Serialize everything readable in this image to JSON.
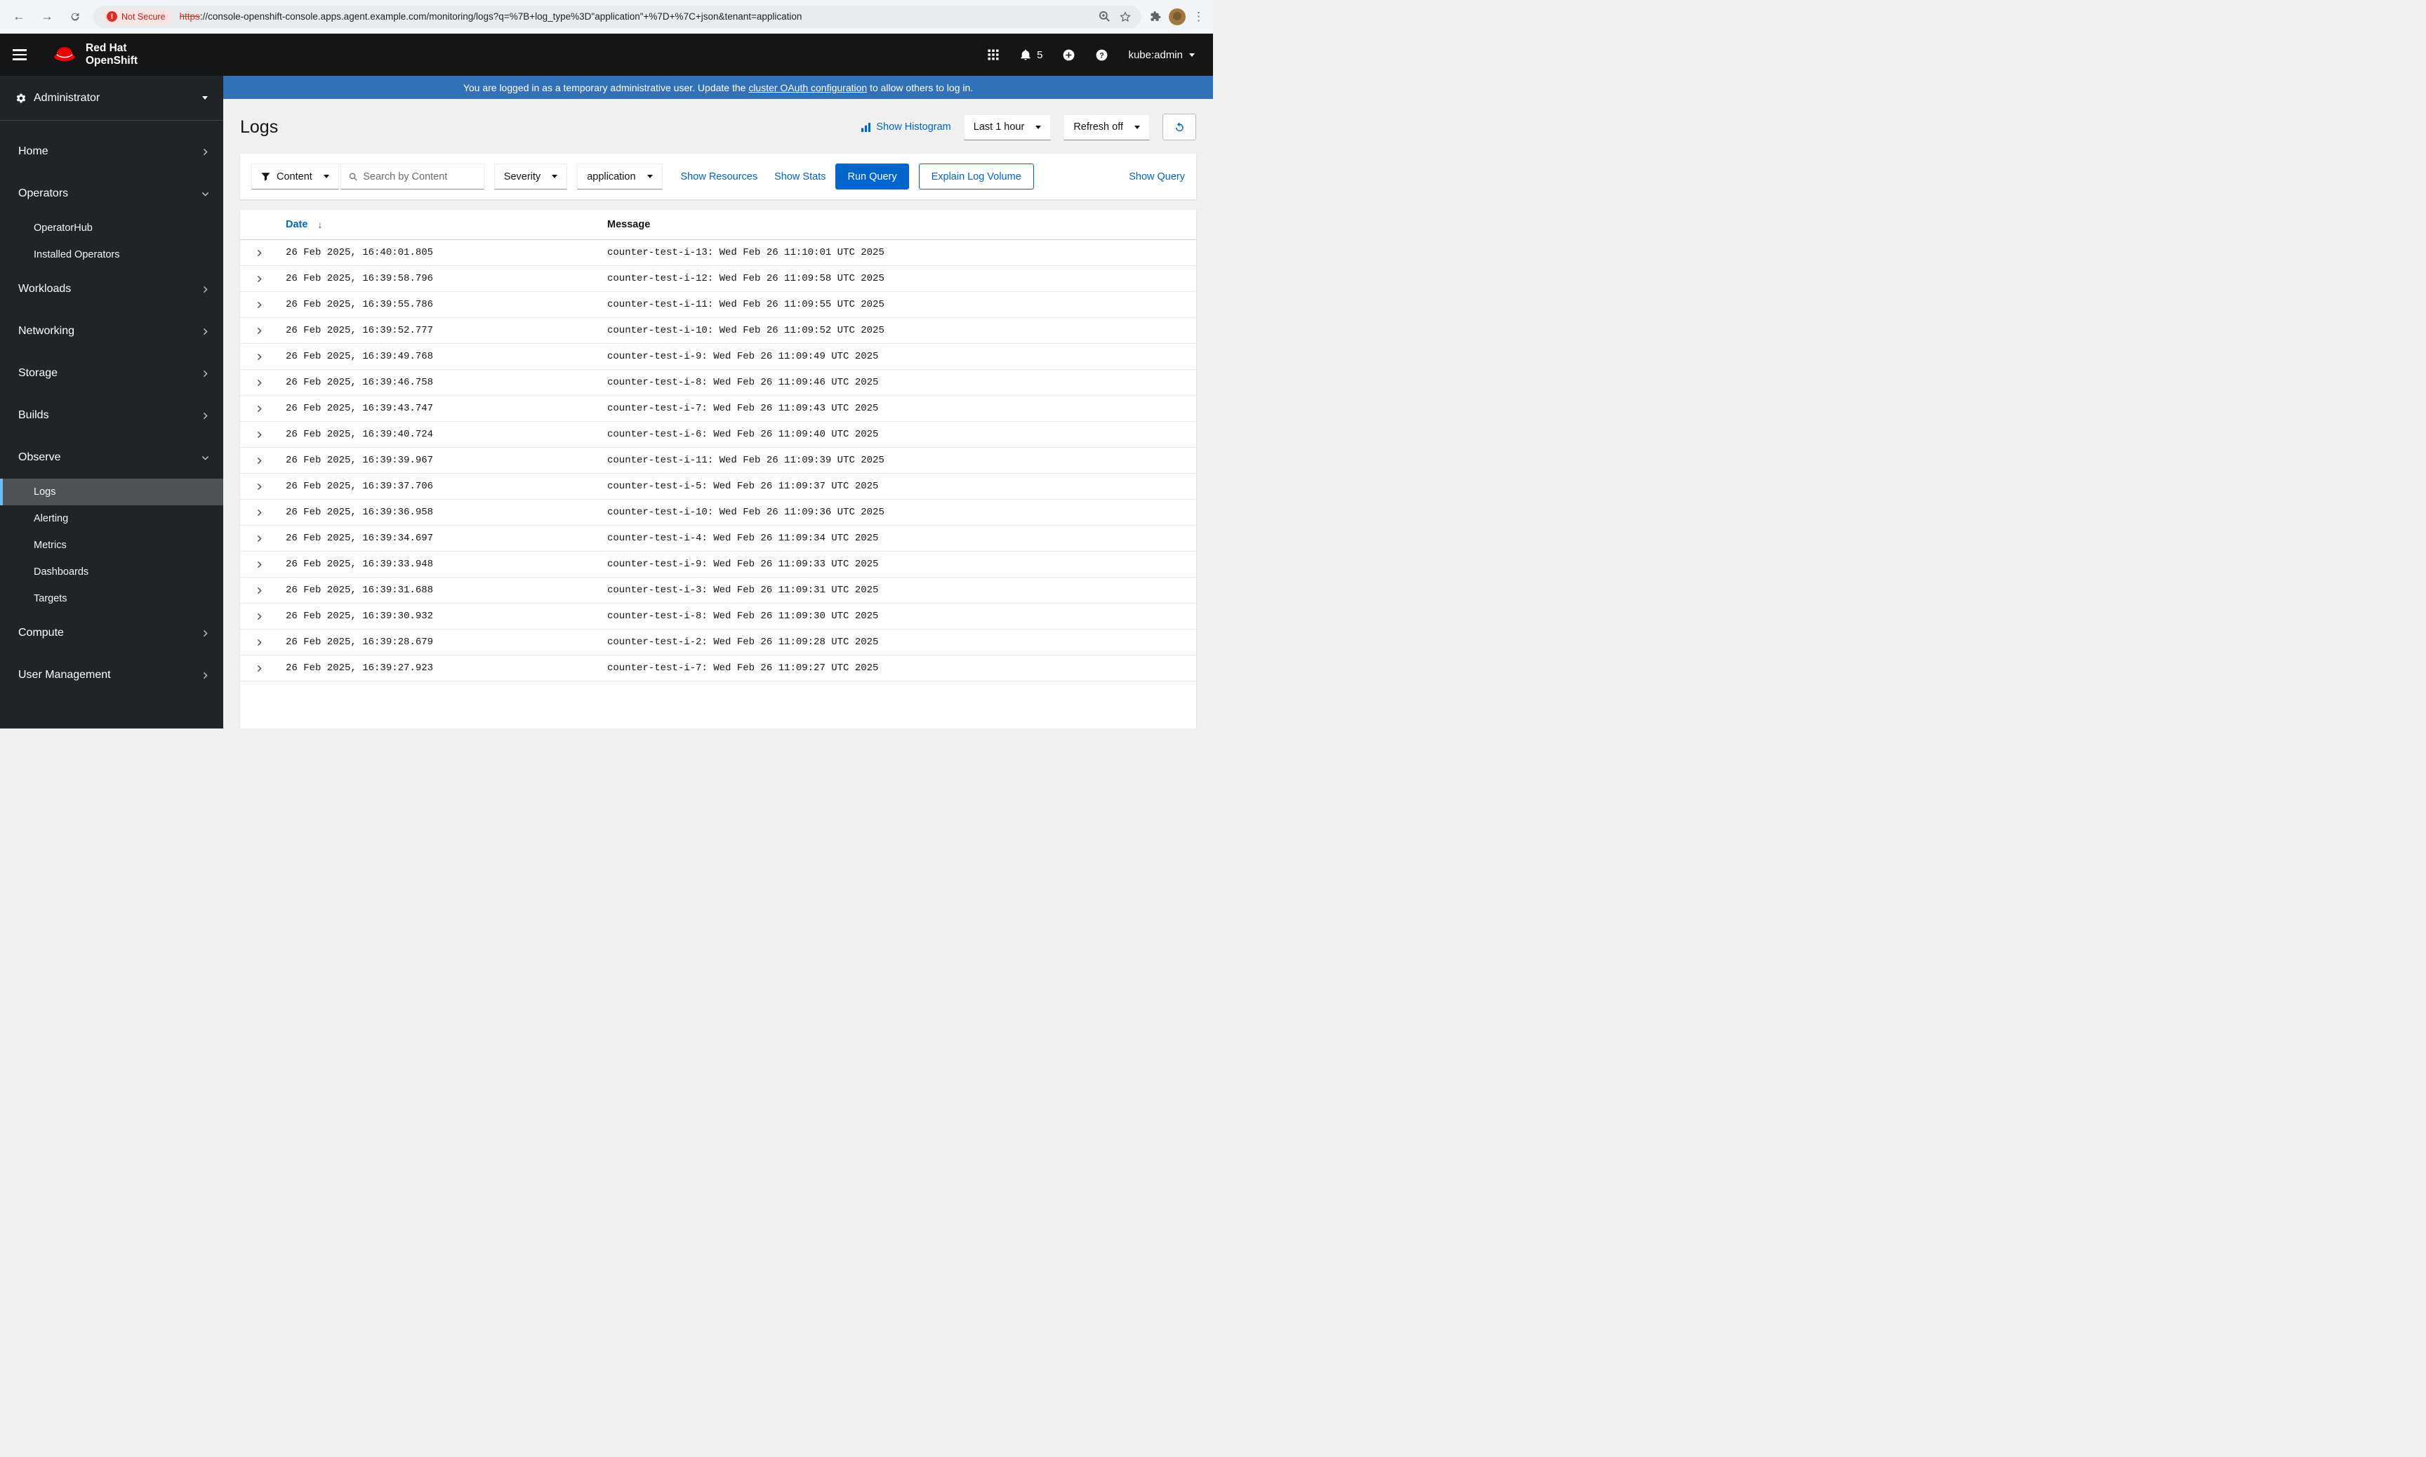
{
  "colors": {
    "masthead_black": "#151515",
    "sidebar_dark": "#212427",
    "banner_blue": "#3270b8",
    "primary_blue": "#0066cc",
    "brand_red": "#ee0000",
    "not_secure_red": "#c5221f"
  },
  "browser": {
    "security_label": "Not Secure",
    "url_protocol": "https",
    "url_rest": "://console-openshift-console.apps.agent.example.com/monitoring/logs?q=%7B+log_type%3D\"application\"+%7D+%7C+json&tenant=application"
  },
  "masthead": {
    "brand_line1": "Red Hat",
    "brand_line2": "OpenShift",
    "notification_count": "5",
    "username": "kube:admin"
  },
  "banner": {
    "text_before": "You are logged in as a temporary administrative user. Update the ",
    "link_text": "cluster OAuth configuration",
    "text_after": " to allow others to log in."
  },
  "sidebar": {
    "perspective": "Administrator",
    "items": [
      {
        "label": "Home",
        "expanded": false
      },
      {
        "label": "Operators",
        "expanded": true,
        "children": [
          {
            "label": "OperatorHub"
          },
          {
            "label": "Installed Operators"
          }
        ]
      },
      {
        "label": "Workloads",
        "expanded": false
      },
      {
        "label": "Networking",
        "expanded": false
      },
      {
        "label": "Storage",
        "expanded": false
      },
      {
        "label": "Builds",
        "expanded": false
      },
      {
        "label": "Observe",
        "expanded": true,
        "children": [
          {
            "label": "Logs",
            "active": true
          },
          {
            "label": "Alerting"
          },
          {
            "label": "Metrics"
          },
          {
            "label": "Dashboards"
          },
          {
            "label": "Targets"
          }
        ]
      },
      {
        "label": "Compute",
        "expanded": false
      },
      {
        "label": "User Management",
        "expanded": false
      }
    ]
  },
  "page": {
    "title": "Logs",
    "show_histogram_label": "Show Histogram",
    "time_range_value": "Last 1 hour",
    "refresh_value": "Refresh off"
  },
  "toolbar": {
    "content_filter_value": "Content",
    "search_placeholder": "Search by Content",
    "severity_value": "Severity",
    "tenant_value": "application",
    "show_resources_label": "Show Resources",
    "show_stats_label": "Show Stats",
    "run_query_label": "Run Query",
    "explain_label": "Explain Log Volume",
    "show_query_label": "Show Query"
  },
  "table": {
    "columns": {
      "date": "Date",
      "message": "Message"
    },
    "rows": [
      {
        "date": "26 Feb 2025, 16:40:01.805",
        "message": "counter-test-i-13: Wed Feb 26 11:10:01 UTC 2025"
      },
      {
        "date": "26 Feb 2025, 16:39:58.796",
        "message": "counter-test-i-12: Wed Feb 26 11:09:58 UTC 2025"
      },
      {
        "date": "26 Feb 2025, 16:39:55.786",
        "message": "counter-test-i-11: Wed Feb 26 11:09:55 UTC 2025"
      },
      {
        "date": "26 Feb 2025, 16:39:52.777",
        "message": "counter-test-i-10: Wed Feb 26 11:09:52 UTC 2025"
      },
      {
        "date": "26 Feb 2025, 16:39:49.768",
        "message": "counter-test-i-9: Wed Feb 26 11:09:49 UTC 2025"
      },
      {
        "date": "26 Feb 2025, 16:39:46.758",
        "message": "counter-test-i-8: Wed Feb 26 11:09:46 UTC 2025"
      },
      {
        "date": "26 Feb 2025, 16:39:43.747",
        "message": "counter-test-i-7: Wed Feb 26 11:09:43 UTC 2025"
      },
      {
        "date": "26 Feb 2025, 16:39:40.724",
        "message": "counter-test-i-6: Wed Feb 26 11:09:40 UTC 2025"
      },
      {
        "date": "26 Feb 2025, 16:39:39.967",
        "message": "counter-test-i-11: Wed Feb 26 11:09:39 UTC 2025"
      },
      {
        "date": "26 Feb 2025, 16:39:37.706",
        "message": "counter-test-i-5: Wed Feb 26 11:09:37 UTC 2025"
      },
      {
        "date": "26 Feb 2025, 16:39:36.958",
        "message": "counter-test-i-10: Wed Feb 26 11:09:36 UTC 2025"
      },
      {
        "date": "26 Feb 2025, 16:39:34.697",
        "message": "counter-test-i-4: Wed Feb 26 11:09:34 UTC 2025"
      },
      {
        "date": "26 Feb 2025, 16:39:33.948",
        "message": "counter-test-i-9: Wed Feb 26 11:09:33 UTC 2025"
      },
      {
        "date": "26 Feb 2025, 16:39:31.688",
        "message": "counter-test-i-3: Wed Feb 26 11:09:31 UTC 2025"
      },
      {
        "date": "26 Feb 2025, 16:39:30.932",
        "message": "counter-test-i-8: Wed Feb 26 11:09:30 UTC 2025"
      },
      {
        "date": "26 Feb 2025, 16:39:28.679",
        "message": "counter-test-i-2: Wed Feb 26 11:09:28 UTC 2025"
      },
      {
        "date": "26 Feb 2025, 16:39:27.923",
        "message": "counter-test-i-7: Wed Feb 26 11:09:27 UTC 2025"
      }
    ]
  }
}
